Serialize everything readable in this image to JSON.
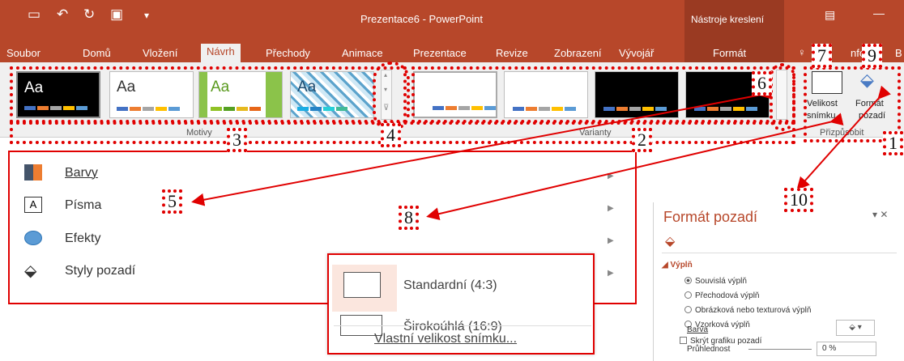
{
  "window": {
    "title": "Prezentace6 - PowerPoint",
    "context_tools": "Nástroje kreslení",
    "qat_icons": [
      "save-icon",
      "undo-icon",
      "redo-icon",
      "presentation-icon",
      "customize-icon"
    ]
  },
  "tabs": [
    {
      "label": "Soubor"
    },
    {
      "label": "Domů"
    },
    {
      "label": "Vložení"
    },
    {
      "label": "Návrh",
      "active": true
    },
    {
      "label": "Přechody"
    },
    {
      "label": "Animace"
    },
    {
      "label": "Prezentace"
    },
    {
      "label": "Revize"
    },
    {
      "label": "Zobrazení"
    },
    {
      "label": "Vývojář"
    },
    {
      "label": "Formát"
    }
  ],
  "tab_extra": {
    "tell_me": "nfc",
    "letter": "B"
  },
  "ribbon": {
    "themes_group_label": "Motivy",
    "variants_group_label": "Varianty",
    "customize_group_label": "Přizpůsobit",
    "theme_thumb_text": "Aa",
    "slide_size_label": "Velikost snímku",
    "format_bg_label": "Formát pozadí",
    "slide_size_line1": "Velikost",
    "slide_size_line2": "snímku",
    "format_bg_line1": "Formát",
    "format_bg_line2": "pozadí"
  },
  "colors": {
    "accent": "#b7472a",
    "annotation": "#e00000",
    "theme_bars": [
      "#4472c4",
      "#ed7d31",
      "#a5a5a5",
      "#ffc000",
      "#5b9bd5",
      "#70ad47"
    ]
  },
  "annotations": [
    "1",
    "2",
    "3",
    "4",
    "5",
    "6",
    "7",
    "8",
    "9",
    "10"
  ],
  "design_menu": {
    "items": [
      {
        "label": "Barvy",
        "icon": "colors-icon"
      },
      {
        "label": "Písma",
        "icon": "fonts-icon"
      },
      {
        "label": "Efekty",
        "icon": "effects-icon"
      },
      {
        "label": "Styly pozadí",
        "icon": "background-styles-icon"
      }
    ]
  },
  "slide_size_menu": {
    "items": [
      "Standardní (4:3)",
      "Širokoúhlá (16:9)"
    ],
    "custom": "Vlastní velikost snímku..."
  },
  "format_pane": {
    "title": "Formát pozadí",
    "section": "Výplň",
    "options": [
      {
        "label": "Souvislá výplň",
        "selected": true
      },
      {
        "label": "Přechodová výplň",
        "selected": false
      },
      {
        "label": "Obrázková nebo texturová výplň",
        "selected": false
      },
      {
        "label": "Vzorková výplň",
        "selected": false
      }
    ],
    "hide_graphics": "Skrýt grafiku pozadí",
    "color_label": "Barva",
    "transparency_label": "Průhlednost",
    "transparency_value": "0 %"
  }
}
